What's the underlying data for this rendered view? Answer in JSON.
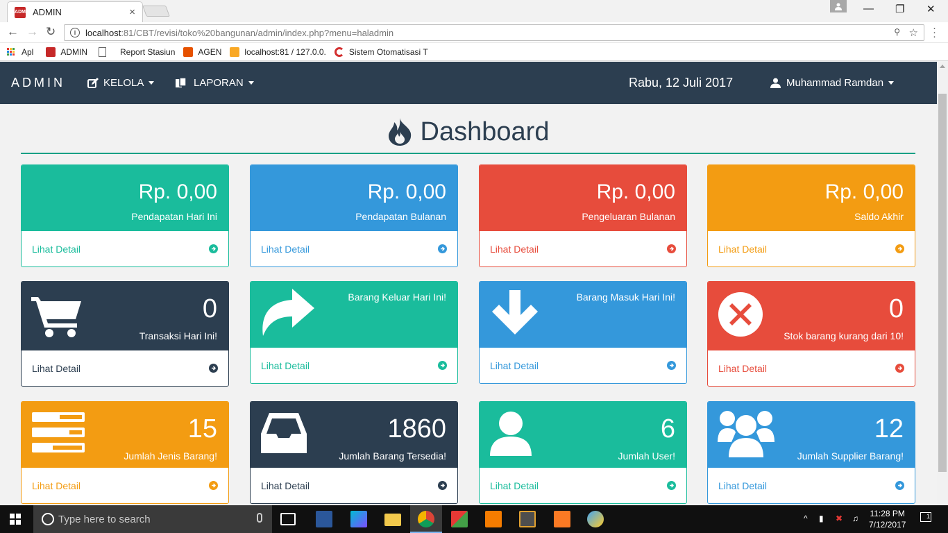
{
  "browser": {
    "tab_title": "ADMIN",
    "tab_close": "×",
    "url_host": "localhost",
    "url_path": ":81/CBT/revisi/toko%20bangunan/admin/index.php?menu=haladmin",
    "bookmarks": [
      {
        "label": "Apl"
      },
      {
        "label": "ADMIN"
      },
      {
        "label": "Report Stasiun"
      },
      {
        "label": "AGEN"
      },
      {
        "label": "localhost:81 / 127.0.0."
      },
      {
        "label": "Sistem Otomatisasi T"
      }
    ]
  },
  "navbar": {
    "brand": "ADMIN",
    "menu_kelola": "KELOLA",
    "menu_laporan": "LAPORAN",
    "date": "Rabu, 12 Juli 2017",
    "user": "Muhammad Ramdan"
  },
  "page": {
    "title": "Dashboard"
  },
  "panels": {
    "p1": {
      "value": "Rp. 0,00",
      "label": "Pendapatan Hari Ini",
      "link": "Lihat Detail"
    },
    "p2": {
      "value": "Rp. 0,00",
      "label": "Pendapatan Bulanan",
      "link": "Lihat Detail"
    },
    "p3": {
      "value": "Rp. 0,00",
      "label": "Pengeluaran Bulanan",
      "link": "Lihat Detail"
    },
    "p4": {
      "value": "Rp. 0,00",
      "label": "Saldo Akhir",
      "link": "Lihat Detail"
    },
    "p5": {
      "value": "0",
      "label": "Transaksi Hari Ini!",
      "link": "Lihat Detail"
    },
    "p6": {
      "label": "Barang Keluar Hari Ini!",
      "link": "Lihat Detail"
    },
    "p7": {
      "label": "Barang Masuk Hari Ini!",
      "link": "Lihat Detail"
    },
    "p8": {
      "value": "0",
      "label": "Stok barang kurang dari 10!",
      "link": "Lihat Detail"
    },
    "p9": {
      "value": "15",
      "label": "Jumlah Jenis Barang!",
      "link": "Lihat Detail"
    },
    "p10": {
      "value": "1860",
      "label": "Jumlah Barang Tersedia!",
      "link": "Lihat Detail"
    },
    "p11": {
      "value": "6",
      "label": "Jumlah User!",
      "link": "Lihat Detail"
    },
    "p12": {
      "value": "12",
      "label": "Jumlah Supplier Barang!",
      "link": "Lihat Detail"
    }
  },
  "colors": {
    "green": "#1abc9c",
    "blue": "#3498db",
    "red": "#e74c3c",
    "orange": "#f39c12",
    "navy": "#2c3e50"
  },
  "taskbar": {
    "search_placeholder": "Type here to search",
    "time": "11:28 PM",
    "date": "7/12/2017",
    "notification_count": "1"
  }
}
